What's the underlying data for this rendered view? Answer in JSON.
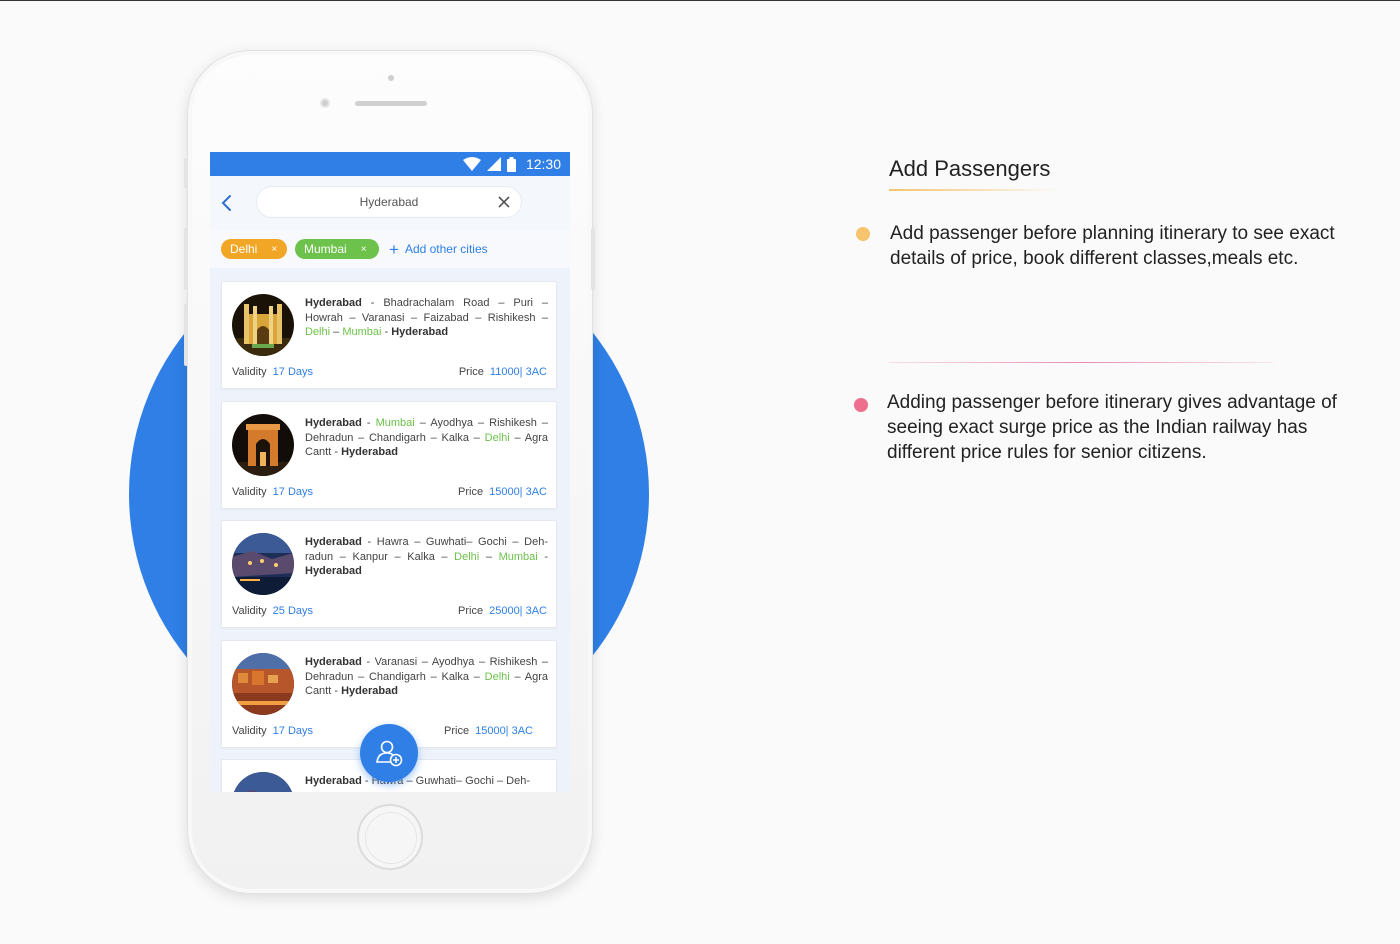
{
  "status_bar": {
    "time": "12:30"
  },
  "search": {
    "value": "Hyderabad"
  },
  "filters": {
    "chips": [
      {
        "label": "Delhi",
        "color": "#f1a626",
        "remove": "×"
      },
      {
        "label": "Mumbai",
        "color": "#6cc24a",
        "remove": "×"
      }
    ],
    "add_label": "Add other cities"
  },
  "cards": [
    {
      "route": [
        {
          "t": "Hyderabad",
          "s": "b"
        },
        {
          "t": " - Bhadrachalam Road – Puri – Howrah – Varanasi – Faizabad – Rishikesh – "
        },
        {
          "t": "Delhi",
          "s": "g"
        },
        {
          "t": " – "
        },
        {
          "t": "Mumbai",
          "s": "g"
        },
        {
          "t": " - "
        },
        {
          "t": "Hyderabad",
          "s": "b"
        }
      ],
      "validity_label": "Validity",
      "validity": "17 Days",
      "price_label": "Price",
      "price": "11000| 3AC"
    },
    {
      "route": [
        {
          "t": "Hyderabad",
          "s": "b"
        },
        {
          "t": " - "
        },
        {
          "t": "Mumbai",
          "s": "g"
        },
        {
          "t": " – Ayodhya – Rishikesh – Dehradun – Chandigarh – Kalka – "
        },
        {
          "t": "Delhi",
          "s": "g"
        },
        {
          "t": " – Agra Cantt - "
        },
        {
          "t": "Hyderabad",
          "s": "b"
        }
      ],
      "validity_label": "Validity",
      "validity": "17 Days",
      "price_label": "Price",
      "price": "15000| 3AC"
    },
    {
      "route": [
        {
          "t": "Hyderabad",
          "s": "b"
        },
        {
          "t": " - Hawra – Guwhati– Gochi – Deh-radun – Kanpur – Kalka – "
        },
        {
          "t": "Delhi",
          "s": "g"
        },
        {
          "t": " – "
        },
        {
          "t": "Mumbai",
          "s": "g"
        },
        {
          "t": " - "
        },
        {
          "t": "Hyderabad",
          "s": "b"
        }
      ],
      "validity_label": "Validity",
      "validity": "25 Days",
      "price_label": "Price",
      "price": "25000| 3AC"
    },
    {
      "route": [
        {
          "t": "Hyderabad",
          "s": "b"
        },
        {
          "t": " - Varanasi – Ayodhya – Rishikesh – Dehradun – Chandigarh – Kalka – "
        },
        {
          "t": "Delhi",
          "s": "g"
        },
        {
          "t": " – Agra Cantt - "
        },
        {
          "t": "Hyderabad",
          "s": "b"
        }
      ],
      "validity_label": "Validity",
      "validity": "17 Days",
      "price_label": "Price",
      "price": "15000| 3AC"
    },
    {
      "route": [
        {
          "t": "Hyderabad",
          "s": "b"
        },
        {
          "t": " - Hawra – Guwhati– Gochi – Deh-"
        }
      ],
      "validity_label": "",
      "validity": "",
      "price_label": "",
      "price": ""
    }
  ],
  "fab": {
    "icon": "add-passenger-icon"
  },
  "feature": {
    "title": "Add Passengers",
    "points": [
      {
        "text": "Add passenger before planning itinerary to see exact details of price, book different classes,meals etc.",
        "color": "#f5c46c"
      },
      {
        "text": "Adding passenger before itinerary gives advantage of seeing exact surge price as the Indian railway has different price rules for senior citizens.",
        "color": "#ee6e8e"
      }
    ]
  }
}
